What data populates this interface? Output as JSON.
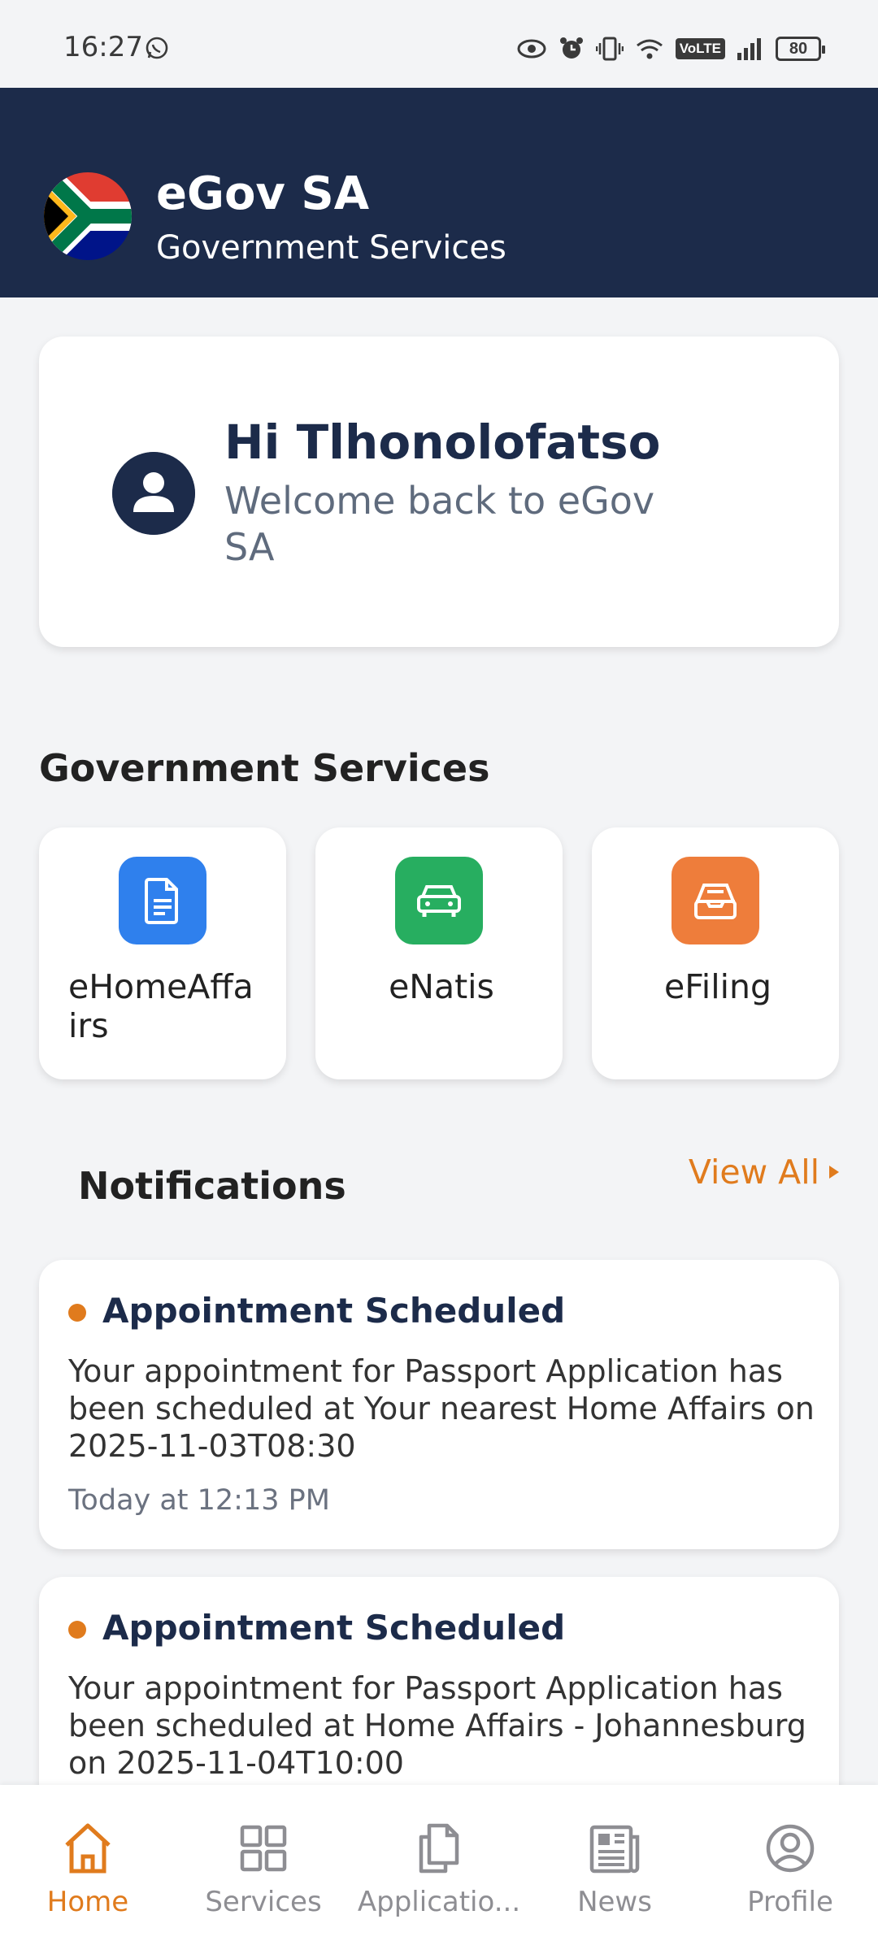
{
  "status_bar": {
    "time": "16:27",
    "battery": "80",
    "volte": "VoLTE"
  },
  "header": {
    "title": "eGov SA",
    "subtitle": "Government Services"
  },
  "welcome": {
    "greeting": "Hi Tlhonolofatso",
    "message": "Welcome back to eGov SA"
  },
  "services": {
    "title": "Government Services",
    "items": [
      {
        "label": "eHomeAffairs",
        "icon": "document-icon",
        "color": "#2f80ed"
      },
      {
        "label": "eNatis",
        "icon": "car-icon",
        "color": "#27ae60"
      },
      {
        "label": "eFiling",
        "icon": "inbox-icon",
        "color": "#ee7d3b"
      }
    ]
  },
  "notifications": {
    "title": "Notifications",
    "view_all": "View All",
    "items": [
      {
        "title": "Appointment Scheduled",
        "body": "Your appointment for Passport Application has been scheduled at Your nearest Home Affairs on 2025-11-03T08:30",
        "time": "Today at 12:13 PM"
      },
      {
        "title": "Appointment Scheduled",
        "body": "Your appointment for Passport Application has been scheduled at Home Affairs - Johannesburg on 2025-11-04T10:00"
      }
    ]
  },
  "bottom_nav": [
    {
      "label": "Home",
      "active": true
    },
    {
      "label": "Services"
    },
    {
      "label": "Applicatio..."
    },
    {
      "label": "News"
    },
    {
      "label": "Profile"
    }
  ],
  "colors": {
    "navy": "#1c2b4a",
    "accent": "#e07b1d",
    "background": "#f3f4f6"
  }
}
